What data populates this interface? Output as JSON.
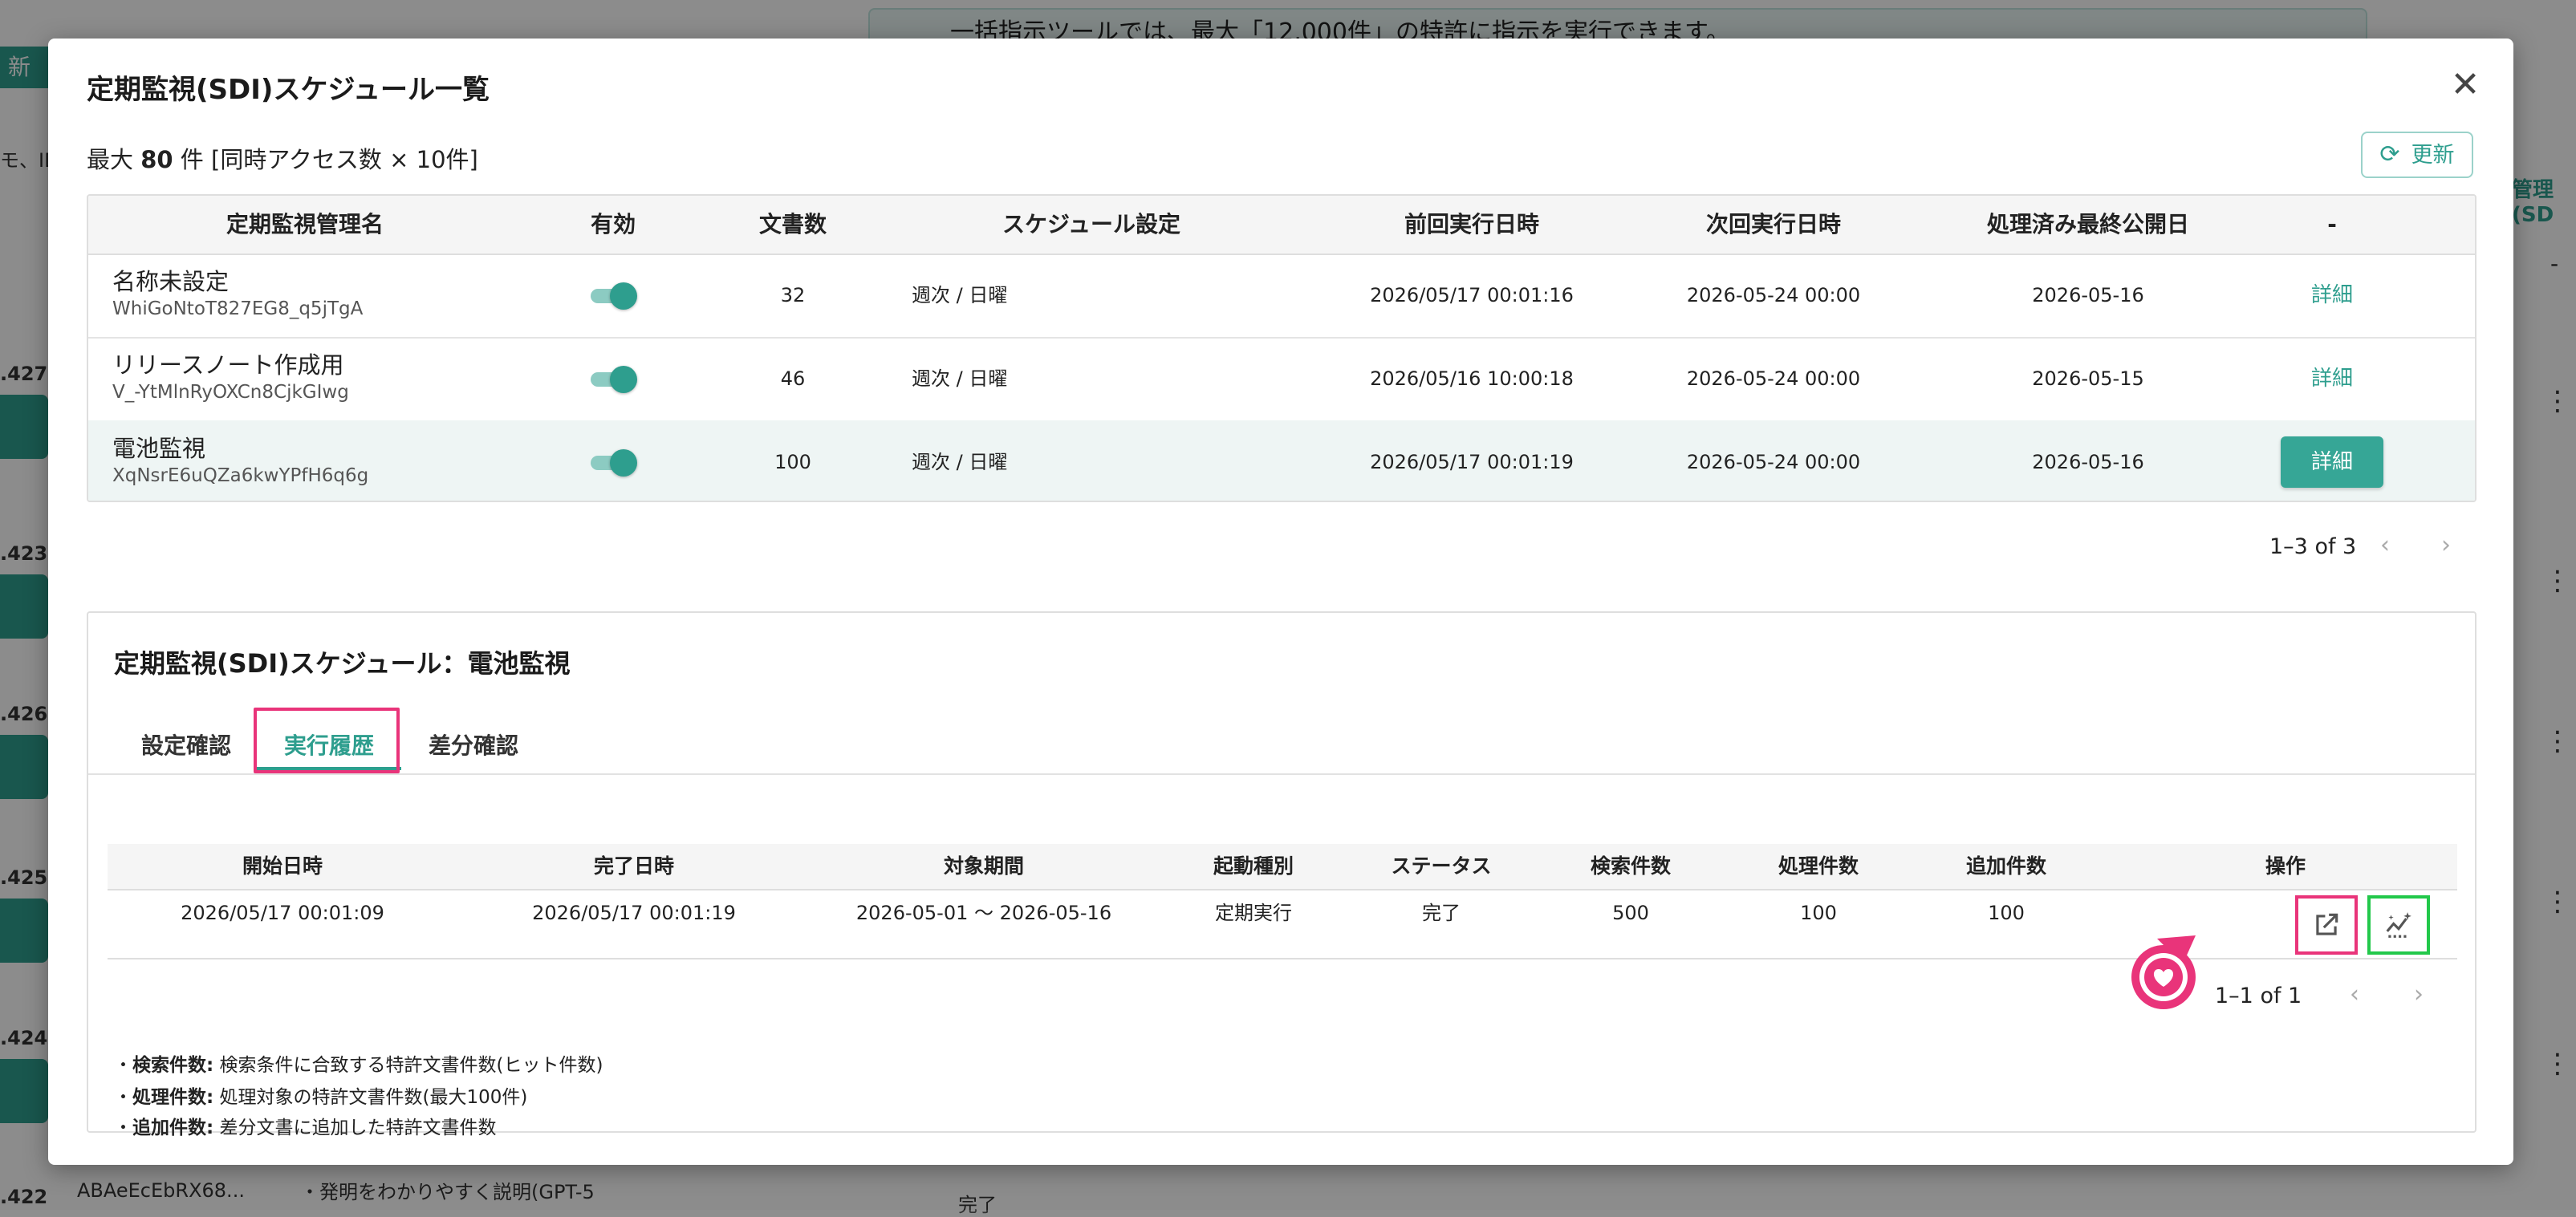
{
  "background": {
    "banner_text": "一括指示ツールでは、最大「12,000件」の特許に指示を実行できます。",
    "top_button": "新",
    "left_text": "モ、ID",
    "right_label": "管理(SD",
    "right_dash": "-",
    "row_numbers": [
      ".427",
      ".423",
      ".426",
      ".425",
      ".424",
      ".422"
    ],
    "bottom_id": "ABAeEcEbRX68...",
    "bottom_desc": "・発明をわかりやすく説明(GPT-5",
    "bottom_status": "完了"
  },
  "modal": {
    "title": "定期監視(SDI)スケジュール一覧",
    "close_icon": "close-icon",
    "max_prefix": "最大 ",
    "max_count": "80",
    "max_suffix": " 件 [同時アクセス数 × 10件]",
    "refresh_label": "更新",
    "refresh_icon": "refresh-icon"
  },
  "schedule_table": {
    "columns": [
      "定期監視管理名",
      "有効",
      "文書数",
      "スケジュール設定",
      "前回実行日時",
      "次回実行日時",
      "処理済み最終公開日",
      "-"
    ],
    "rows": [
      {
        "name": "名称未設定",
        "id": "WhiGoNtoT827EG8_q5jTgA",
        "enabled": true,
        "docs": "32",
        "schedule": "週次 / 日曜",
        "last_run": "2026/05/17 00:01:16",
        "next_run": "2026-05-24 00:00",
        "last_pub": "2026-05-16",
        "action": "詳細"
      },
      {
        "name": "リリースノート作成用",
        "id": "V_-YtMlnRyOXCn8CjkGIwg",
        "enabled": true,
        "docs": "46",
        "schedule": "週次 / 日曜",
        "last_run": "2026/05/16 10:00:18",
        "next_run": "2026-05-24 00:00",
        "last_pub": "2026-05-15",
        "action": "詳細"
      },
      {
        "name": "電池監視",
        "id": "XqNsrE6uQZa6kwYPfH6q6g",
        "enabled": true,
        "docs": "100",
        "schedule": "週次 / 日曜",
        "last_run": "2026/05/17 00:01:19",
        "next_run": "2026-05-24 00:00",
        "last_pub": "2026-05-16",
        "action": "詳細"
      }
    ],
    "pagination": "1–3 of 3"
  },
  "detail_panel": {
    "title": "定期監視(SDI)スケジュール：電池監視",
    "tabs": [
      "設定確認",
      "実行履歴",
      "差分確認"
    ],
    "active_tab": "実行履歴",
    "history_columns": [
      "開始日時",
      "完了日時",
      "対象期間",
      "起動種別",
      "ステータス",
      "検索件数",
      "処理件数",
      "追加件数",
      "操作"
    ],
    "history_rows": [
      {
        "start": "2026/05/17 00:01:09",
        "end": "2026/05/17 00:01:19",
        "period": "2026-05-01 〜 2026-05-16",
        "trigger": "定期実行",
        "status": "完了",
        "searched": "500",
        "processed": "100",
        "added": "100"
      }
    ],
    "history_pagination": "1–1 of 1",
    "notes": [
      {
        "label": "検索件数:",
        "text": " 検索条件に合致する特許文書件数(ヒット件数)"
      },
      {
        "label": "処理件数:",
        "text": " 処理対象の特許文書件数(最大100件)"
      },
      {
        "label": "追加件数:",
        "text": " 差分文書に追加した特許文書件数"
      }
    ],
    "op_icons": [
      "open-in-new-icon",
      "diff-sparkle-icon"
    ]
  },
  "colors": {
    "accent": "#2e9e8e",
    "highlight_pink": "#e9347a",
    "highlight_green": "#22c84a"
  }
}
